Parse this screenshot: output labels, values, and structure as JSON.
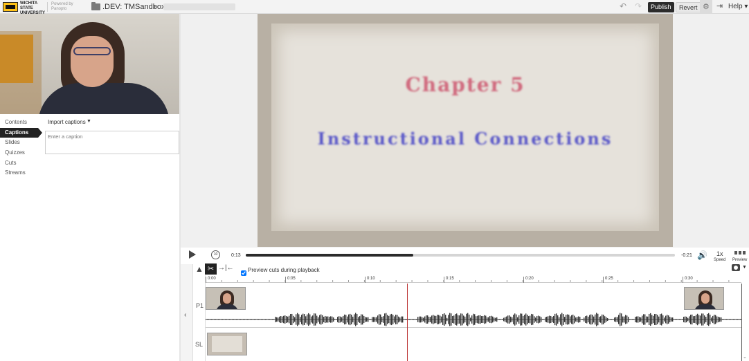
{
  "header": {
    "university": "WICHITA STATE UNIVERSITY",
    "powered_by": "Powered by Panopto",
    "breadcrumb": ".DEV: TMSandbox",
    "publish_label": "Publish",
    "revert_label": "Revert",
    "help_label": "Help"
  },
  "sidebar": {
    "tabs": [
      {
        "label": "Contents"
      },
      {
        "label": "Captions",
        "active": true
      },
      {
        "label": "Slides"
      },
      {
        "label": "Quizzes"
      },
      {
        "label": "Cuts"
      },
      {
        "label": "Streams"
      }
    ],
    "import_captions_label": "Import captions",
    "caption_placeholder": "Enter a caption"
  },
  "player": {
    "slide_title": "Chapter 5",
    "slide_subtitle": "Instructional Connections",
    "current_time": "0:13",
    "remaining_time": "-0:21",
    "progress_fraction": 0.39,
    "speed_value": "1x",
    "speed_label": "Speed",
    "preview_label": "Preview"
  },
  "editor": {
    "preview_cuts_label": "Preview cuts during playback",
    "preview_cuts_checked": true,
    "ticks": [
      "0:00",
      "0:05",
      "0:10",
      "0:15",
      "0:20",
      "0:25",
      "0:30"
    ],
    "lanes": [
      "P1",
      "SL"
    ]
  },
  "icons": {
    "undo": "undo-icon",
    "redo": "redo-icon",
    "settings": "gear-icon",
    "exit": "exit-icon",
    "play": "play-icon",
    "rewind": "rewind-10-icon",
    "volume": "volume-icon",
    "camera": "camera-icon"
  }
}
